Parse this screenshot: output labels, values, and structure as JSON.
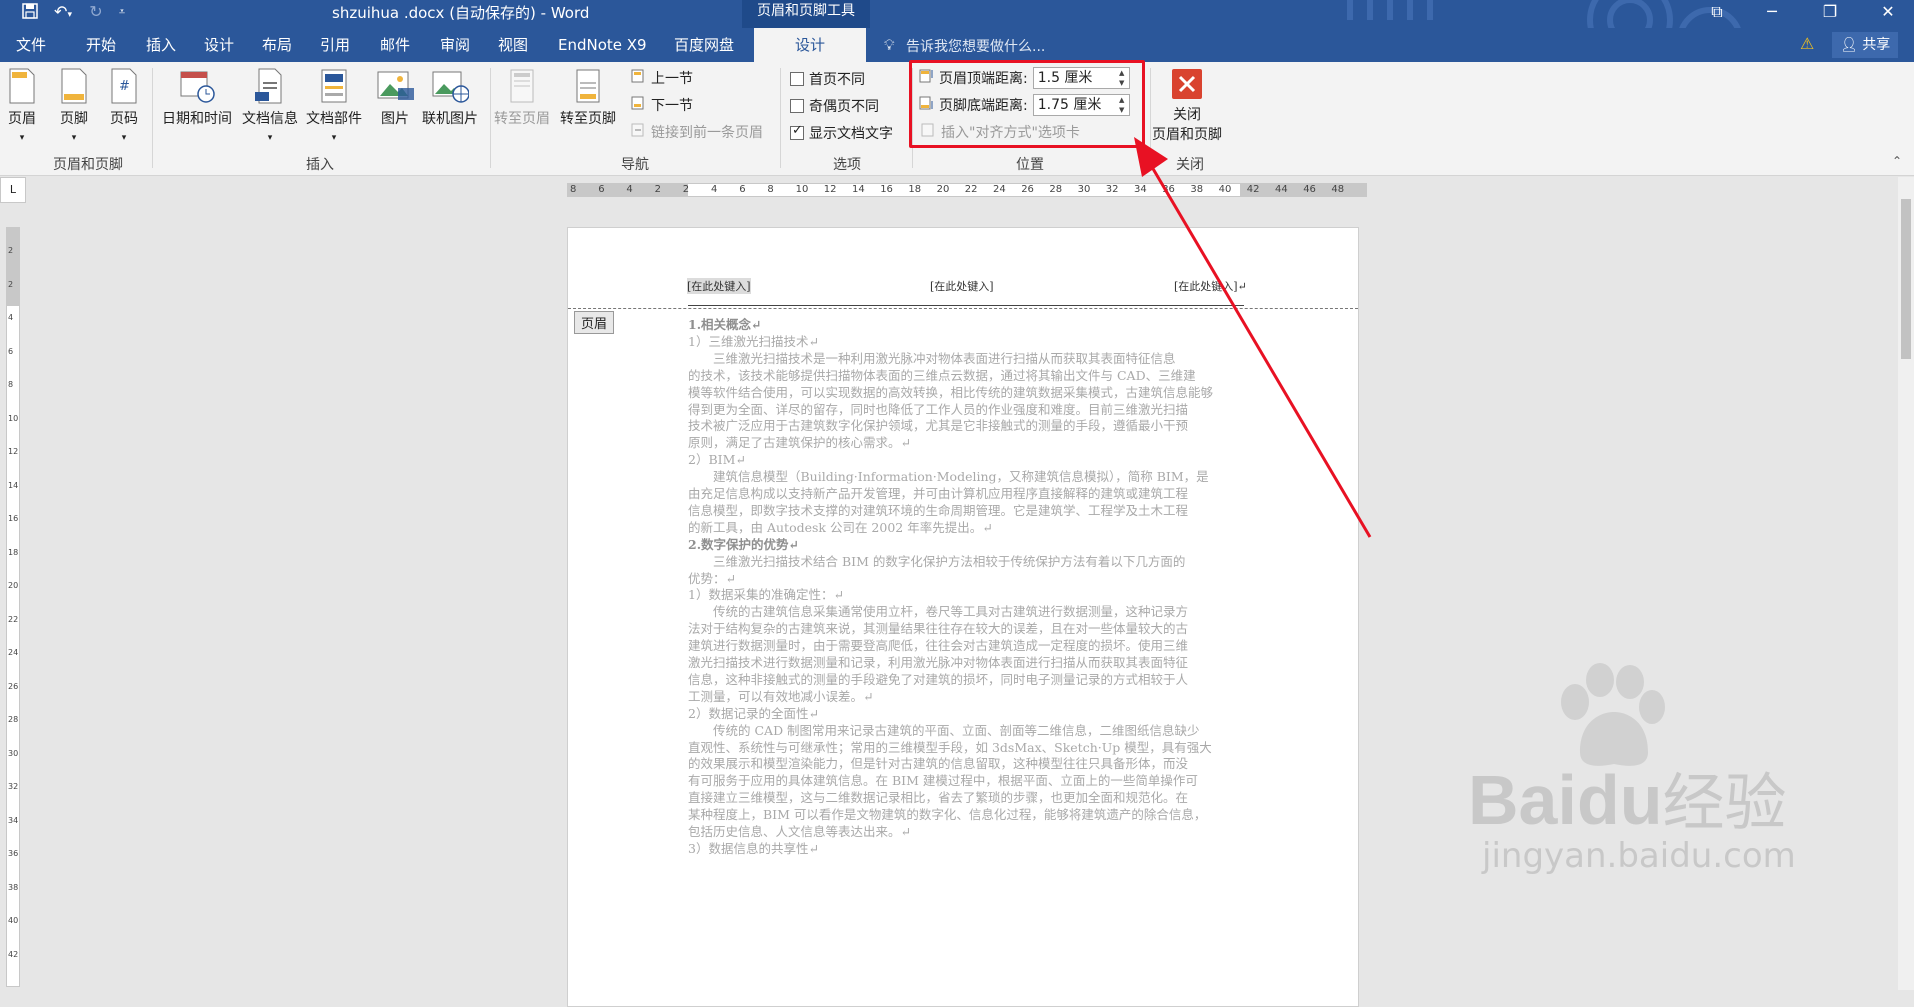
{
  "titlebar": {
    "doc_title": "shzuihua .docx (自动保存的) - Word",
    "context_title": "页眉和页脚工具",
    "qat": {
      "save_icon": "save-icon",
      "undo_icon": "undo-icon",
      "redo_icon": "redo-icon",
      "customize_icon": "customize-qat-icon"
    },
    "controls": {
      "ribbon_display": "ribbon-display-icon",
      "minimize": "minimize-icon",
      "restore": "restore-icon",
      "close": "close-icon"
    }
  },
  "tabs": [
    "文件",
    "开始",
    "插入",
    "设计",
    "布局",
    "引用",
    "邮件",
    "审阅",
    "视图",
    "EndNote X9",
    "百度网盘",
    "设计"
  ],
  "tell_me": "告诉我您想要做什么...",
  "share": "共享",
  "ribbon": {
    "group_header_footer": {
      "header": "页眉",
      "footer": "页脚",
      "page_number": "页码",
      "label": "页眉和页脚"
    },
    "group_insert": {
      "date_time": "日期和时间",
      "doc_info": "文档信息",
      "doc_parts": "文档部件",
      "picture": "图片",
      "online_picture": "联机图片",
      "label": "插入"
    },
    "group_nav": {
      "goto_header": "转至页眉",
      "goto_footer": "转至页脚",
      "prev": "上一节",
      "next": "下一节",
      "link_prev": "链接到前一条页眉",
      "label": "导航"
    },
    "group_options": {
      "first_page": "首页不同",
      "odd_even": "奇偶页不同",
      "show_text": "显示文档文字",
      "label": "选项",
      "show_text_checked": true
    },
    "group_position": {
      "header_top_label": "页眉顶端距离:",
      "header_top_value": "1.5 厘米",
      "footer_bottom_label": "页脚底端距离:",
      "footer_bottom_value": "1.75 厘米",
      "insert_align_tab": "插入\"对齐方式\"选项卡",
      "label": "位置"
    },
    "group_close": {
      "close_label_line1": "关闭",
      "close_label_line2": "页眉和页脚",
      "label": "关闭"
    }
  },
  "ruler": {
    "corner": "L",
    "ticks": [
      "8",
      "6",
      "4",
      "2",
      "2",
      "4",
      "6",
      "8",
      "10",
      "12",
      "14",
      "16",
      "18",
      "20",
      "22",
      "24",
      "26",
      "28",
      "30",
      "32",
      "34",
      "36",
      "38",
      "40",
      "42",
      "44",
      "46",
      "48"
    ],
    "vticks": [
      "2",
      "2",
      "4",
      "6",
      "8",
      "10",
      "12",
      "14",
      "16",
      "18",
      "20",
      "22",
      "24",
      "26",
      "28",
      "30",
      "32",
      "34",
      "36",
      "38",
      "40",
      "42"
    ]
  },
  "document": {
    "header_placeholders": [
      "[在此处键入]",
      "[在此处键入]",
      "[在此处键入]↵"
    ],
    "header_tag": "页眉",
    "lines": [
      "1.相关概念↵",
      "1）三维激光扫描技术↵",
      "　　三维激光扫描技术是一种利用激光脉冲对物体表面进行扫描从而获取其表面特征信息",
      "的技术，该技术能够提供扫描物体表面的三维点云数据，通过将其输出文件与 CAD、三维建",
      "模等软件结合使用，可以实现数据的高效转换，相比传统的建筑数据采集模式，古建筑信息能够",
      "得到更为全面、详尽的留存，同时也降低了工作人员的作业强度和难度。目前三维激光扫描",
      "技术被广泛应用于古建筑数字化保护领域，尤其是它非接触式的测量的手段，遵循最小干预",
      "原则，满足了古建筑保护的核心需求。↵",
      "2）BIM↵",
      "　　建筑信息模型（Building·Information·Modeling，又称建筑信息模拟），简称 BIM，是",
      "由充足信息构成以支持新产品开发管理，并可由计算机应用程序直接解释的建筑或建筑工程",
      "信息模型，即数字技术支撑的对建筑环境的生命周期管理。它是建筑学、工程学及土木工程",
      "的新工具，由 Autodesk 公司在 2002 年率先提出。↵",
      "2.数字保护的优势↵",
      "　　三维激光扫描技术结合 BIM 的数字化保护方法相较于传统保护方法有着以下几方面的",
      "优势：↵",
      "1）数据采集的准确定性：↵",
      "　　传统的古建筑信息采集通常使用立杆，卷尺等工具对古建筑进行数据测量，这种记录方",
      "法对于结构复杂的古建筑来说，其测量结果往往存在较大的误差，且在对一些体量较大的古",
      "建筑进行数据测量时，由于需要登高爬低，往往会对古建筑造成一定程度的损坏。使用三维",
      "激光扫描技术进行数据测量和记录，利用激光脉冲对物体表面进行扫描从而获取其表面特征",
      "信息，这种非接触式的测量的手段避免了对建筑的损坏，同时电子测量记录的方式相较于人",
      "工测量，可以有效地减小误差。↵",
      "2）数据记录的全面性↵",
      "　　传统的 CAD 制图常用来记录古建筑的平面、立面、剖面等二维信息，二维图纸信息缺少",
      "直观性、系统性与可继承性；常用的三维模型手段，如 3dsMax、Sketch·Up 模型，具有强大",
      "的效果展示和模型渲染能力，但是针对古建筑的信息留取，这种模型往往只具备形体，而没",
      "有可服务于应用的具体建筑信息。在 BIM 建模过程中，根据平面、立面上的一些简单操作可",
      "直接建立三维模型，这与二维数据记录相比，省去了繁琐的步骤，也更加全面和规范化。在",
      "某种程度上，BIM 可以看作是文物建筑的数字化、信息化过程，能够将建筑遗产的除合信息，",
      "包括历史信息、人文信息等表达出来。↵",
      "3）数据信息的共享性↵"
    ],
    "bold_lines": [
      0,
      13
    ]
  },
  "watermark": {
    "brand": "Bai",
    "brand2": "du",
    "cn": "经验",
    "url": "jingyan.baidu.com"
  },
  "colors": {
    "accent": "#2b579a",
    "highlight": "#e81123",
    "ribbon_bg": "#f3f3f3"
  }
}
